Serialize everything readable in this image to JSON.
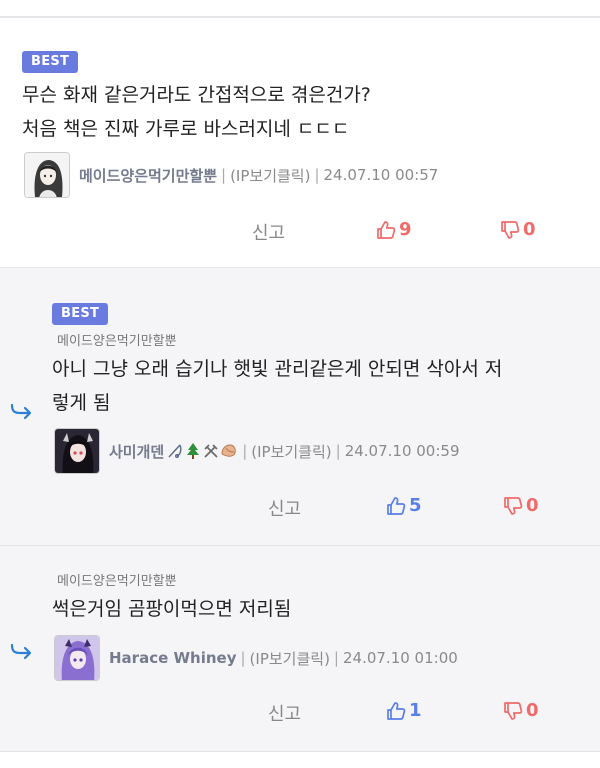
{
  "comments": [
    {
      "badge": "BEST",
      "lines": [
        "무슨 화재 같은거라도 간접적으로 겪은건가?",
        "처음 책은 진짜 가루로 바스러지네 ㄷㄷㄷ"
      ],
      "author": "메이드양은먹기만할뿐",
      "ip": "(IP보기클릭)",
      "date": "24.07.10 00:57",
      "report": "신고",
      "likes": "9",
      "dislikes": "0"
    },
    {
      "badge": "BEST",
      "reply_to": "메이드양은먹기만할뿐",
      "lines": [
        "아니 그냥 오래 습기나 햇빛 관리같은게 안되면 삭아서 저",
        "렇게 됨"
      ],
      "author": "사미개덴",
      "ip": "(IP보기클릭)",
      "date": "24.07.10 00:59",
      "report": "신고",
      "likes": "5",
      "dislikes": "0"
    },
    {
      "reply_to": "메이드양은먹기만할뿐",
      "lines": [
        "썩은거임 곰팡이먹으면 저리됨"
      ],
      "author": "Harace Whiney",
      "ip": "(IP보기클릭)",
      "date": "24.07.10 01:00",
      "report": "신고",
      "likes": "1",
      "dislikes": "0"
    }
  ],
  "colors": {
    "badge": "#6a7be0",
    "like_red": "#f06a6a",
    "like_blue": "#5a7ee8",
    "reply_arrow": "#2b7fd8"
  },
  "icons": [
    "thumbs-up-icon",
    "thumbs-down-icon",
    "reply-arrow-icon",
    "avatar"
  ]
}
